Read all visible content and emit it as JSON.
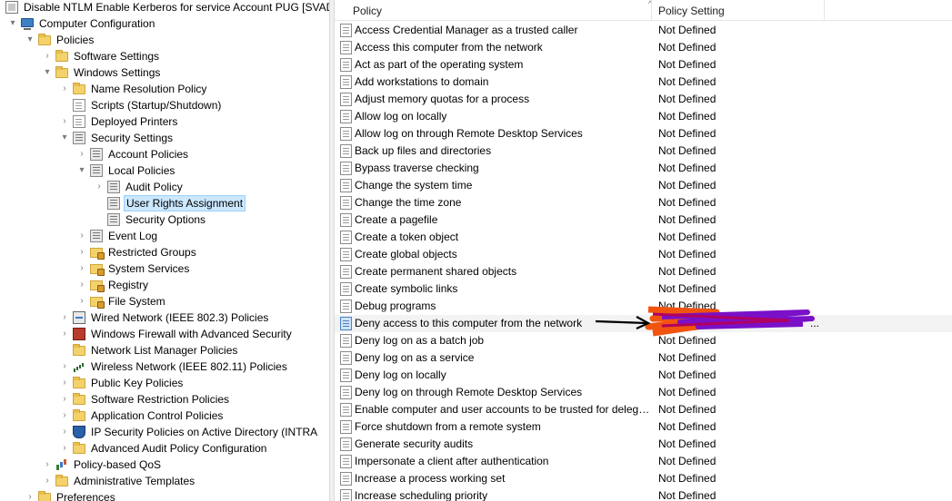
{
  "tree": {
    "rows": [
      {
        "label": "Disable NTLM Enable Kerberos for service Account PUG [SVADD",
        "expander": "",
        "icon": "gpo-icon"
      },
      {
        "label": "Computer Configuration",
        "expander": "▾",
        "icon": "computer-icon"
      },
      {
        "label": "Policies",
        "expander": "▾",
        "icon": "folder-icon"
      },
      {
        "label": "Software Settings",
        "expander": "›",
        "icon": "folder-icon"
      },
      {
        "label": "Windows Settings",
        "expander": "▾",
        "icon": "folder-icon"
      },
      {
        "label": "Name Resolution Policy",
        "expander": "›",
        "icon": "folder-icon"
      },
      {
        "label": "Scripts (Startup/Shutdown)",
        "expander": "",
        "icon": "script-icon"
      },
      {
        "label": "Deployed Printers",
        "expander": "›",
        "icon": "printer-icon"
      },
      {
        "label": "Security Settings",
        "expander": "▾",
        "icon": "security-icon"
      },
      {
        "label": "Account Policies",
        "expander": "›",
        "icon": "policy-icon"
      },
      {
        "label": "Local Policies",
        "expander": "▾",
        "icon": "policy-icon"
      },
      {
        "label": "Audit Policy",
        "expander": "›",
        "icon": "policy-icon"
      },
      {
        "label": "User Rights Assignment",
        "expander": "",
        "icon": "policy-icon"
      },
      {
        "label": "Security Options",
        "expander": "",
        "icon": "policy-icon"
      },
      {
        "label": "Event Log",
        "expander": "›",
        "icon": "policy-icon"
      },
      {
        "label": "Restricted Groups",
        "expander": "›",
        "icon": "lock-folder-icon"
      },
      {
        "label": "System Services",
        "expander": "›",
        "icon": "lock-folder-icon"
      },
      {
        "label": "Registry",
        "expander": "›",
        "icon": "lock-folder-icon"
      },
      {
        "label": "File System",
        "expander": "›",
        "icon": "lock-folder-icon"
      },
      {
        "label": "Wired Network (IEEE 802.3) Policies",
        "expander": "›",
        "icon": "network-icon"
      },
      {
        "label": "Windows Firewall with Advanced Security",
        "expander": "›",
        "icon": "firewall-icon"
      },
      {
        "label": "Network List Manager Policies",
        "expander": "",
        "icon": "folder-icon"
      },
      {
        "label": "Wireless Network (IEEE 802.11) Policies",
        "expander": "›",
        "icon": "wireless-icon"
      },
      {
        "label": "Public Key Policies",
        "expander": "›",
        "icon": "folder-icon"
      },
      {
        "label": "Software Restriction Policies",
        "expander": "›",
        "icon": "folder-icon"
      },
      {
        "label": "Application Control Policies",
        "expander": "›",
        "icon": "folder-icon"
      },
      {
        "label": "IP Security Policies on Active Directory (INTRA",
        "expander": "›",
        "icon": "shield-icon"
      },
      {
        "label": "Advanced Audit Policy Configuration",
        "expander": "›",
        "icon": "folder-icon"
      },
      {
        "label": "Policy-based QoS",
        "expander": "›",
        "icon": "chart-icon"
      },
      {
        "label": "Administrative Templates",
        "expander": "›",
        "icon": "folder-icon"
      },
      {
        "label": "Preferences",
        "expander": "›",
        "icon": "folder-icon"
      }
    ],
    "selected_label": "User Rights Assignment"
  },
  "list": {
    "columns": {
      "policy": "Policy",
      "setting": "Policy Setting",
      "sort_indicator": "^"
    },
    "rows": [
      {
        "policy": "Access Credential Manager as a trusted caller",
        "setting": "Not Defined"
      },
      {
        "policy": "Access this computer from the network",
        "setting": "Not Defined"
      },
      {
        "policy": "Act as part of the operating system",
        "setting": "Not Defined"
      },
      {
        "policy": "Add workstations to domain",
        "setting": "Not Defined"
      },
      {
        "policy": "Adjust memory quotas for a process",
        "setting": "Not Defined"
      },
      {
        "policy": "Allow log on locally",
        "setting": "Not Defined"
      },
      {
        "policy": "Allow log on through Remote Desktop Services",
        "setting": "Not Defined"
      },
      {
        "policy": "Back up files and directories",
        "setting": "Not Defined"
      },
      {
        "policy": "Bypass traverse checking",
        "setting": "Not Defined"
      },
      {
        "policy": "Change the system time",
        "setting": "Not Defined"
      },
      {
        "policy": "Change the time zone",
        "setting": "Not Defined"
      },
      {
        "policy": "Create a pagefile",
        "setting": "Not Defined"
      },
      {
        "policy": "Create a token object",
        "setting": "Not Defined"
      },
      {
        "policy": "Create global objects",
        "setting": "Not Defined"
      },
      {
        "policy": "Create permanent shared objects",
        "setting": "Not Defined"
      },
      {
        "policy": "Create symbolic links",
        "setting": "Not Defined"
      },
      {
        "policy": "Debug programs",
        "setting": "Not Defined"
      },
      {
        "policy": "Deny access to this computer from the network",
        "setting": "..."
      },
      {
        "policy": "Deny log on as a batch job",
        "setting": "Not Defined"
      },
      {
        "policy": "Deny log on as a service",
        "setting": "Not Defined"
      },
      {
        "policy": "Deny log on locally",
        "setting": "Not Defined"
      },
      {
        "policy": "Deny log on through Remote Desktop Services",
        "setting": "Not Defined"
      },
      {
        "policy": "Enable computer and user accounts to be trusted for delega...",
        "setting": "Not Defined"
      },
      {
        "policy": "Force shutdown from a remote system",
        "setting": "Not Defined"
      },
      {
        "policy": "Generate security audits",
        "setting": "Not Defined"
      },
      {
        "policy": "Impersonate a client after authentication",
        "setting": "Not Defined"
      },
      {
        "policy": "Increase a process working set",
        "setting": "Not Defined"
      },
      {
        "policy": "Increase scheduling priority",
        "setting": "Not Defined"
      }
    ],
    "highlighted_policy": "Deny access to this computer from the network"
  },
  "colors": {
    "selection": "#cce8ff",
    "selection_border": "#99d1ff",
    "row_hover": "#f3f3f3",
    "redaction_orange": "#f0540f",
    "redaction_purple": "#7a10c8"
  }
}
